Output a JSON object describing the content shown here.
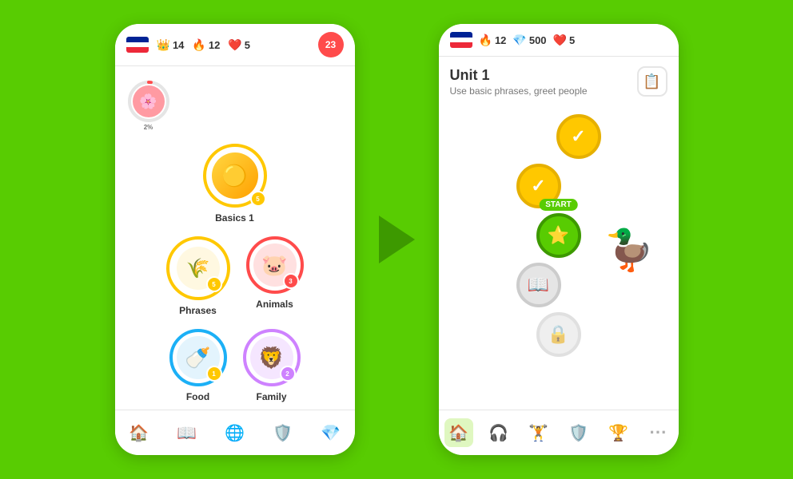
{
  "app": {
    "background_color": "#58cc02"
  },
  "left_phone": {
    "top_bar": {
      "flag": "french",
      "stats": [
        {
          "icon": "crown",
          "value": "14",
          "color": "#ffc800"
        },
        {
          "icon": "fire",
          "value": "12",
          "color": "#ff4500"
        },
        {
          "icon": "heart",
          "value": "5",
          "color": "#ff4b4b"
        }
      ],
      "notification": "23"
    },
    "profile": {
      "avatar_emoji": "🌸",
      "progress": "2%"
    },
    "lessons": [
      {
        "id": "basics1",
        "label": "Basics 1",
        "emoji": "🟡",
        "badge": "5"
      },
      {
        "id": "phrases",
        "label": "Phrases",
        "emoji": "🌾",
        "badge": "5"
      },
      {
        "id": "animals",
        "label": "Animals",
        "emoji": "🐷",
        "badge": "3"
      },
      {
        "id": "food",
        "label": "Food",
        "emoji": "🍼",
        "badge": "1"
      },
      {
        "id": "family",
        "label": "Family",
        "emoji": "🦁",
        "badge": "2"
      }
    ],
    "bottom_nav": [
      {
        "id": "home",
        "icon": "🏠",
        "active": true
      },
      {
        "id": "book",
        "icon": "📖",
        "active": false
      },
      {
        "id": "globe",
        "icon": "🌐",
        "active": false
      },
      {
        "id": "shield",
        "icon": "🛡️",
        "active": false
      },
      {
        "id": "gem",
        "icon": "💎",
        "active": false
      }
    ]
  },
  "right_phone": {
    "top_bar": {
      "flag": "french",
      "stats": [
        {
          "icon": "fire",
          "value": "12",
          "color": "#ff4500"
        },
        {
          "icon": "gem",
          "value": "500",
          "color": "#1cb0f6"
        },
        {
          "icon": "heart",
          "value": "5",
          "color": "#ff4b4b"
        }
      ]
    },
    "unit": {
      "title": "Unit 1",
      "description": "Use basic phrases, greet people"
    },
    "path_nodes": [
      {
        "type": "gold",
        "icon": "✓",
        "offset": "right"
      },
      {
        "type": "gold",
        "icon": "✓",
        "offset": "left"
      },
      {
        "type": "green",
        "icon": "⭐",
        "label": "START",
        "offset": "none",
        "has_owl": true
      },
      {
        "type": "gray",
        "icon": "📖",
        "offset": "left"
      },
      {
        "type": "gray",
        "icon": "🔒",
        "offset": "none"
      }
    ],
    "bottom_nav": [
      {
        "id": "home",
        "icon": "🏠",
        "active": true,
        "color": "#58cc02"
      },
      {
        "id": "headphones",
        "icon": "🎧",
        "active": false
      },
      {
        "id": "dumbbell",
        "icon": "🏋️",
        "active": false
      },
      {
        "id": "shield",
        "icon": "🛡️",
        "active": false
      },
      {
        "id": "trophy",
        "icon": "🏆",
        "active": false
      },
      {
        "id": "more",
        "icon": "⋯",
        "active": false
      }
    ]
  }
}
